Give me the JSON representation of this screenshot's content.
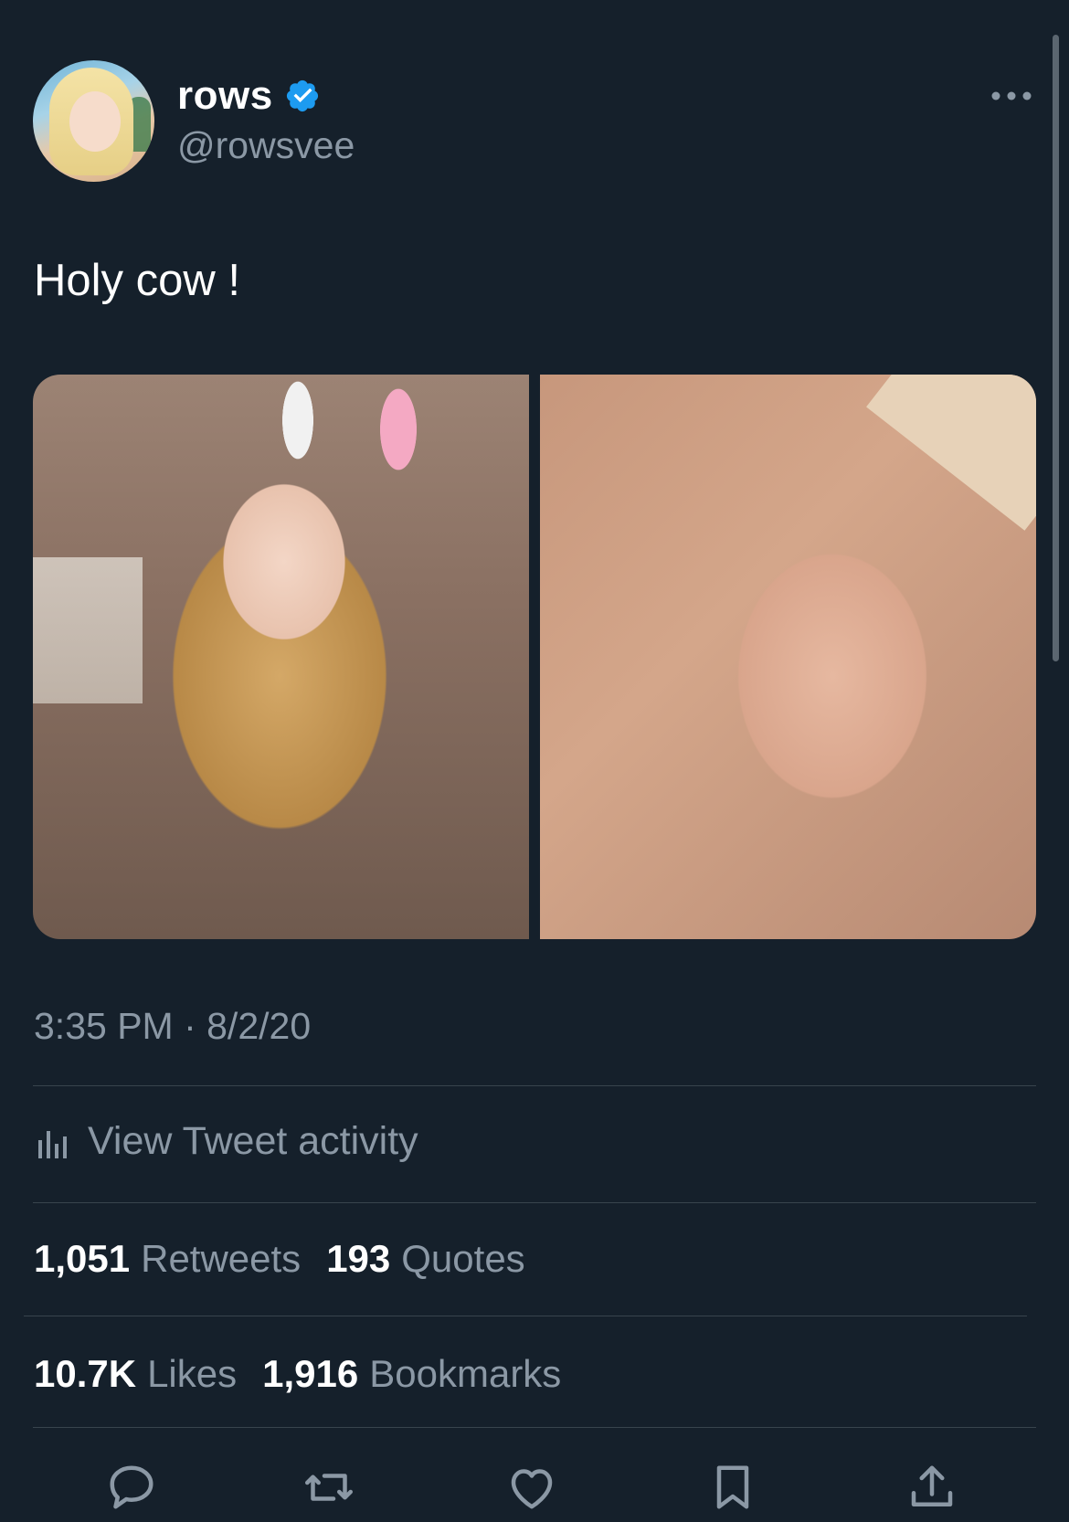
{
  "author": {
    "name": "rows",
    "handle": "@rowsvee",
    "verified": true
  },
  "tweet": {
    "text": "Holy cow !",
    "timestamp": "3:35 PM · 8/2/20"
  },
  "activity": {
    "label": "View Tweet activity"
  },
  "stats": {
    "retweets_count": "1,051",
    "retweets_label": "Retweets",
    "quotes_count": "193",
    "quotes_label": "Quotes",
    "likes_count": "10.7K",
    "likes_label": "Likes",
    "bookmarks_count": "1,916",
    "bookmarks_label": "Bookmarks"
  },
  "icons": {
    "verified": "verified-badge-icon",
    "more": "more-options-icon",
    "activity": "bar-chart-icon",
    "reply": "reply-icon",
    "retweet": "retweet-icon",
    "like": "heart-icon",
    "bookmark": "bookmark-icon",
    "share": "share-icon"
  },
  "colors": {
    "background": "#15202b",
    "secondary_text": "#8b98a5",
    "divider": "#38444d",
    "verified_blue": "#1d9bf0"
  }
}
